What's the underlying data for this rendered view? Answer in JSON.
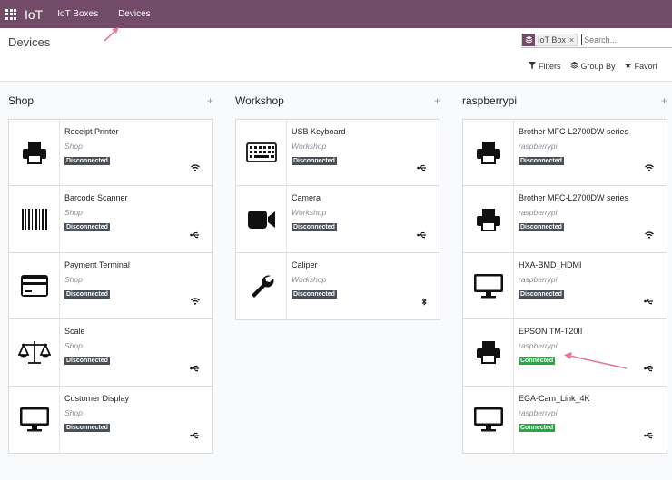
{
  "nav": {
    "brand": "IoT",
    "items": [
      "IoT Boxes",
      "Devices"
    ]
  },
  "control": {
    "title": "Devices",
    "facet_label": "IoT Box",
    "facet_close": "×",
    "search_placeholder": "Search...",
    "filters": [
      "Filters",
      "Group By",
      "Favori"
    ]
  },
  "columns": [
    {
      "title": "Shop",
      "plus": "+",
      "devices": [
        {
          "name": "Receipt Printer",
          "location": "Shop",
          "status": "Disconnected",
          "icon": "printer-icon",
          "connection": "wifi-icon"
        },
        {
          "name": "Barcode Scanner",
          "location": "Shop",
          "status": "Disconnected",
          "icon": "barcode-icon",
          "connection": "usb-icon"
        },
        {
          "name": "Payment Terminal",
          "location": "Shop",
          "status": "Disconnected",
          "icon": "credit-card-icon",
          "connection": "wifi-icon"
        },
        {
          "name": "Scale",
          "location": "Shop",
          "status": "Disconnected",
          "icon": "scale-icon",
          "connection": "usb-icon"
        },
        {
          "name": "Customer Display",
          "location": "Shop",
          "status": "Disconnected",
          "icon": "monitor-icon",
          "connection": "usb-icon"
        }
      ]
    },
    {
      "title": "Workshop",
      "plus": "+",
      "devices": [
        {
          "name": "USB Keyboard",
          "location": "Workshop",
          "status": "Disconnected",
          "icon": "keyboard-icon",
          "connection": "usb-icon"
        },
        {
          "name": "Camera",
          "location": "Workshop",
          "status": "Disconnected",
          "icon": "video-camera-icon",
          "connection": "usb-icon"
        },
        {
          "name": "Caliper",
          "location": "Workshop",
          "status": "Disconnected",
          "icon": "wrench-icon",
          "connection": "bluetooth-icon"
        }
      ]
    },
    {
      "title": "raspberrypi",
      "plus": "+",
      "devices": [
        {
          "name": "Brother MFC-L2700DW series",
          "location": "raspberrypi",
          "status": "Disconnected",
          "icon": "printer-icon",
          "connection": "wifi-icon"
        },
        {
          "name": "Brother MFC-L2700DW series",
          "location": "raspberrypi",
          "status": "Disconnected",
          "icon": "printer-icon",
          "connection": "wifi-icon"
        },
        {
          "name": "HXA-BMD_HDMI",
          "location": "raspberrypi",
          "status": "Disconnected",
          "icon": "monitor-icon",
          "connection": "usb-icon"
        },
        {
          "name": "EPSON TM-T20II",
          "location": "raspberrypi",
          "status": "Connected",
          "icon": "printer-icon",
          "connection": "usb-icon"
        },
        {
          "name": "EGA-Cam_Link_4K",
          "location": "raspberrypi",
          "status": "Connected",
          "icon": "monitor-icon",
          "connection": "usb-icon"
        }
      ]
    }
  ],
  "colors": {
    "navbar": "#714b67",
    "connected": "#28a745",
    "disconnected": "#495057",
    "annotation_arrow": "#e8769a"
  }
}
